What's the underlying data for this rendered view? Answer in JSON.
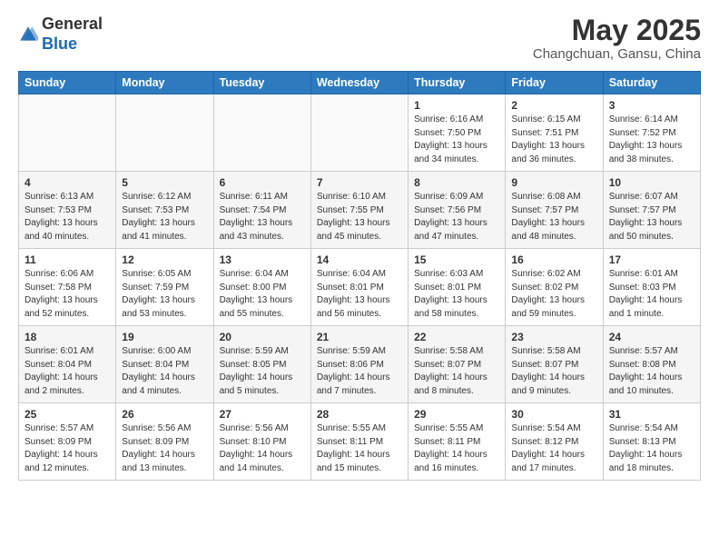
{
  "header": {
    "logo_line1": "General",
    "logo_line2": "Blue",
    "main_title": "May 2025",
    "subtitle": "Changchuan, Gansu, China"
  },
  "days_of_week": [
    "Sunday",
    "Monday",
    "Tuesday",
    "Wednesday",
    "Thursday",
    "Friday",
    "Saturday"
  ],
  "weeks": [
    [
      {
        "day": "",
        "info": ""
      },
      {
        "day": "",
        "info": ""
      },
      {
        "day": "",
        "info": ""
      },
      {
        "day": "",
        "info": ""
      },
      {
        "day": "1",
        "info": "Sunrise: 6:16 AM\nSunset: 7:50 PM\nDaylight: 13 hours\nand 34 minutes."
      },
      {
        "day": "2",
        "info": "Sunrise: 6:15 AM\nSunset: 7:51 PM\nDaylight: 13 hours\nand 36 minutes."
      },
      {
        "day": "3",
        "info": "Sunrise: 6:14 AM\nSunset: 7:52 PM\nDaylight: 13 hours\nand 38 minutes."
      }
    ],
    [
      {
        "day": "4",
        "info": "Sunrise: 6:13 AM\nSunset: 7:53 PM\nDaylight: 13 hours\nand 40 minutes."
      },
      {
        "day": "5",
        "info": "Sunrise: 6:12 AM\nSunset: 7:53 PM\nDaylight: 13 hours\nand 41 minutes."
      },
      {
        "day": "6",
        "info": "Sunrise: 6:11 AM\nSunset: 7:54 PM\nDaylight: 13 hours\nand 43 minutes."
      },
      {
        "day": "7",
        "info": "Sunrise: 6:10 AM\nSunset: 7:55 PM\nDaylight: 13 hours\nand 45 minutes."
      },
      {
        "day": "8",
        "info": "Sunrise: 6:09 AM\nSunset: 7:56 PM\nDaylight: 13 hours\nand 47 minutes."
      },
      {
        "day": "9",
        "info": "Sunrise: 6:08 AM\nSunset: 7:57 PM\nDaylight: 13 hours\nand 48 minutes."
      },
      {
        "day": "10",
        "info": "Sunrise: 6:07 AM\nSunset: 7:57 PM\nDaylight: 13 hours\nand 50 minutes."
      }
    ],
    [
      {
        "day": "11",
        "info": "Sunrise: 6:06 AM\nSunset: 7:58 PM\nDaylight: 13 hours\nand 52 minutes."
      },
      {
        "day": "12",
        "info": "Sunrise: 6:05 AM\nSunset: 7:59 PM\nDaylight: 13 hours\nand 53 minutes."
      },
      {
        "day": "13",
        "info": "Sunrise: 6:04 AM\nSunset: 8:00 PM\nDaylight: 13 hours\nand 55 minutes."
      },
      {
        "day": "14",
        "info": "Sunrise: 6:04 AM\nSunset: 8:01 PM\nDaylight: 13 hours\nand 56 minutes."
      },
      {
        "day": "15",
        "info": "Sunrise: 6:03 AM\nSunset: 8:01 PM\nDaylight: 13 hours\nand 58 minutes."
      },
      {
        "day": "16",
        "info": "Sunrise: 6:02 AM\nSunset: 8:02 PM\nDaylight: 13 hours\nand 59 minutes."
      },
      {
        "day": "17",
        "info": "Sunrise: 6:01 AM\nSunset: 8:03 PM\nDaylight: 14 hours\nand 1 minute."
      }
    ],
    [
      {
        "day": "18",
        "info": "Sunrise: 6:01 AM\nSunset: 8:04 PM\nDaylight: 14 hours\nand 2 minutes."
      },
      {
        "day": "19",
        "info": "Sunrise: 6:00 AM\nSunset: 8:04 PM\nDaylight: 14 hours\nand 4 minutes."
      },
      {
        "day": "20",
        "info": "Sunrise: 5:59 AM\nSunset: 8:05 PM\nDaylight: 14 hours\nand 5 minutes."
      },
      {
        "day": "21",
        "info": "Sunrise: 5:59 AM\nSunset: 8:06 PM\nDaylight: 14 hours\nand 7 minutes."
      },
      {
        "day": "22",
        "info": "Sunrise: 5:58 AM\nSunset: 8:07 PM\nDaylight: 14 hours\nand 8 minutes."
      },
      {
        "day": "23",
        "info": "Sunrise: 5:58 AM\nSunset: 8:07 PM\nDaylight: 14 hours\nand 9 minutes."
      },
      {
        "day": "24",
        "info": "Sunrise: 5:57 AM\nSunset: 8:08 PM\nDaylight: 14 hours\nand 10 minutes."
      }
    ],
    [
      {
        "day": "25",
        "info": "Sunrise: 5:57 AM\nSunset: 8:09 PM\nDaylight: 14 hours\nand 12 minutes."
      },
      {
        "day": "26",
        "info": "Sunrise: 5:56 AM\nSunset: 8:09 PM\nDaylight: 14 hours\nand 13 minutes."
      },
      {
        "day": "27",
        "info": "Sunrise: 5:56 AM\nSunset: 8:10 PM\nDaylight: 14 hours\nand 14 minutes."
      },
      {
        "day": "28",
        "info": "Sunrise: 5:55 AM\nSunset: 8:11 PM\nDaylight: 14 hours\nand 15 minutes."
      },
      {
        "day": "29",
        "info": "Sunrise: 5:55 AM\nSunset: 8:11 PM\nDaylight: 14 hours\nand 16 minutes."
      },
      {
        "day": "30",
        "info": "Sunrise: 5:54 AM\nSunset: 8:12 PM\nDaylight: 14 hours\nand 17 minutes."
      },
      {
        "day": "31",
        "info": "Sunrise: 5:54 AM\nSunset: 8:13 PM\nDaylight: 14 hours\nand 18 minutes."
      }
    ]
  ]
}
